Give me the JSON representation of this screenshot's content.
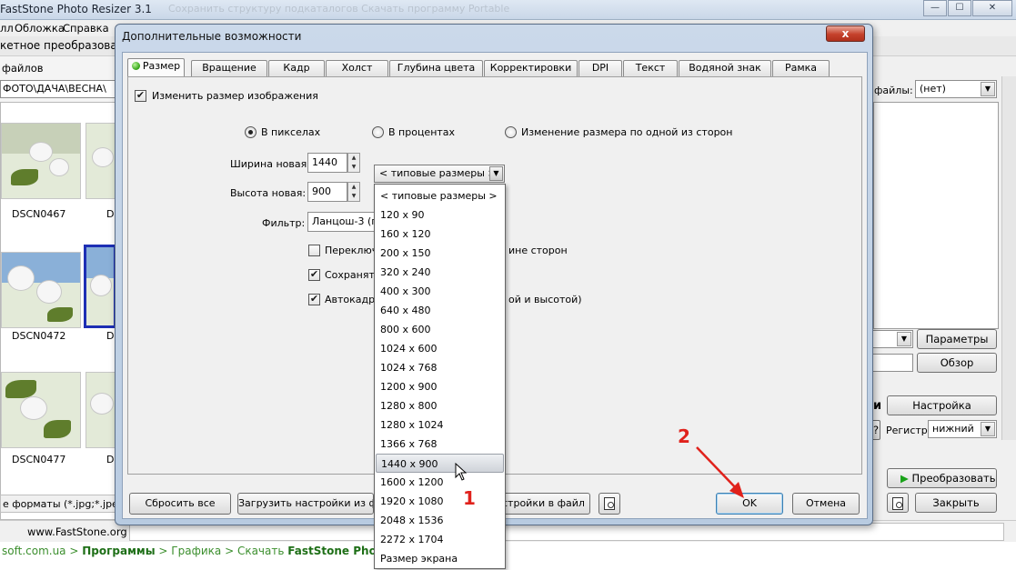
{
  "app": {
    "title": "FastStone Photo Resizer 3.1",
    "title_faded": "Сохранить структуру подкаталогов        Скачать программу Portable",
    "menu": [
      "лл",
      "Обложка",
      "Справка"
    ],
    "toolbar_label": "кетное преобразован",
    "files_label": "файлов",
    "path": "ФОТО\\ДАЧА\\ВЕСНА\\",
    "thumbnails": [
      {
        "label": "DSCN0467"
      },
      {
        "label": "D"
      },
      {
        "label": "DSCN0472"
      },
      {
        "label": "D"
      },
      {
        "label": "DSCN0477"
      },
      {
        "label": "D"
      }
    ],
    "filter_text": "е форматы (*.jpg;*.jpe;*",
    "right": {
      "files_label": "файлы:",
      "files_value": "(нет)",
      "params_button": "Параметры",
      "browse_button": "Обзор",
      "settings_label_fragment": "и",
      "settings_button": "Настройка",
      "case_label": "Регистр:",
      "case_value": "нижний",
      "question": "?",
      "convert_button": "Преобразовать",
      "close_button": "Закрыть"
    },
    "status_site": "www.FastStone.org",
    "browser_breadcrumb_prefix": "soft.com.ua",
    "browser_breadcrumb_sep": ">",
    "browser_breadcrumb_programs": "Программы",
    "browser_breadcrumb_graphics": "Графика",
    "browser_breadcrumb_download": "Скачать",
    "browser_breadcrumb_product": "FastStone Photo R"
  },
  "window_buttons": {
    "minimize": "—",
    "maximize": "☐",
    "close": "✕"
  },
  "dialog": {
    "title": "Дополнительные возможности",
    "close": "x",
    "tabs": [
      "Размер",
      "Вращение",
      "Кадр",
      "Холст",
      "Глубина цвета",
      "Корректировки",
      "DPI",
      "Текст",
      "Водяной знак",
      "Рамка"
    ],
    "resize_checkbox": "Изменить размер изображения",
    "mode_pixels": "В пикселах",
    "mode_percent": "В процентах",
    "mode_one_side": "Изменение размера по одной из сторон",
    "width_label": "Ширина новая:",
    "width_value": "1440",
    "height_label": "Высота новая:",
    "height_value": "900",
    "filter_label": "Фильтр:",
    "filter_value": "Ланцош-3 (по",
    "preset_value": "< типовые размеры >",
    "option1": "Переключ",
    "option1_tail": "ине сторон",
    "option2": "Сохранят",
    "option3": "Автокадри",
    "option3_tail": "ой и высотой)",
    "reset_button": "Сбросить все",
    "load_button": "Загрузить настройки из ф",
    "save_button": "стройки в файл",
    "ok_button": "OK",
    "cancel_button": "Отмена"
  },
  "dropdown": {
    "items": [
      "< типовые размеры >",
      "120 x 90",
      "160 x 120",
      "200 x 150",
      "320 x 240",
      "400 x 300",
      "640 x 480",
      "800 x 600",
      "1024 x 600",
      "1024 x 768",
      "1200 x 900",
      "1280 x 800",
      "1280 x 1024",
      "1366 x 768",
      "1440 x 900",
      "1600 x 1200",
      "1920 x 1080",
      "2048 x 1536",
      "2272 x 1704",
      "Размер экрана"
    ],
    "selected_index": 14
  },
  "annotations": {
    "one": "1",
    "two": "2",
    "color": "#e0221c"
  }
}
